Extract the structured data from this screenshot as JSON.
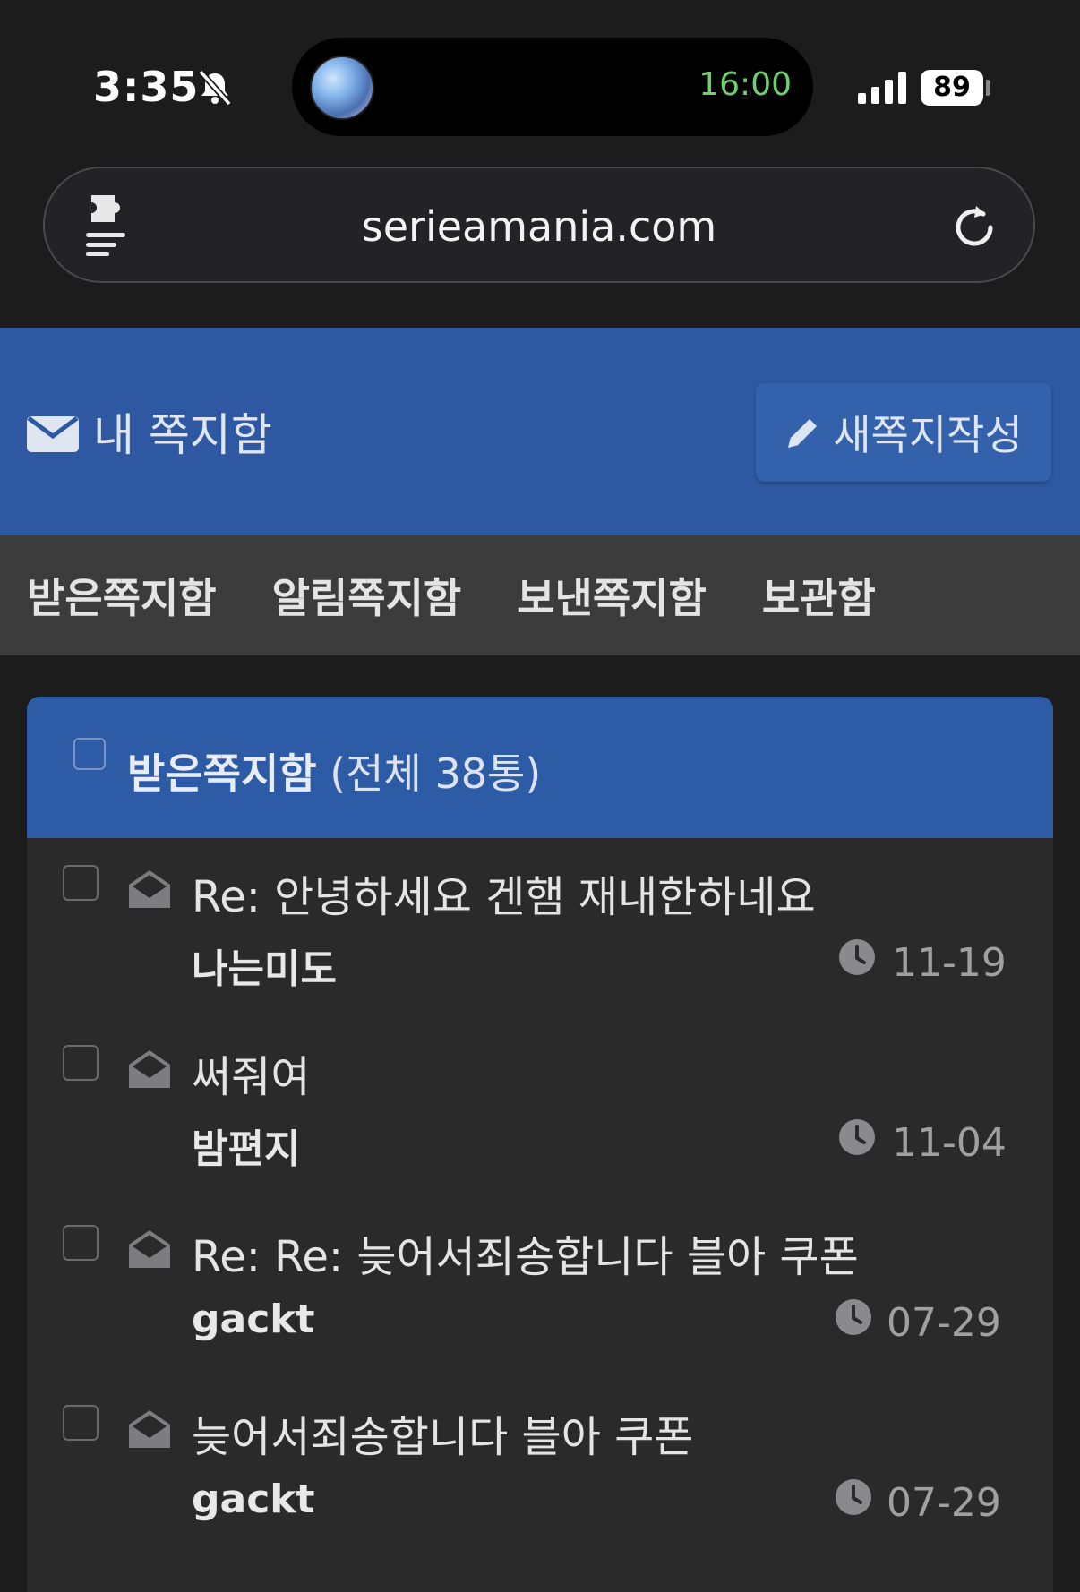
{
  "status_bar": {
    "time": "3:35",
    "live_activity_timer": "16:00",
    "battery": "89"
  },
  "browser": {
    "url": "serieamania.com"
  },
  "header": {
    "title": "내 쪽지함",
    "compose_label": "새쪽지작성"
  },
  "tabs": [
    {
      "label": "받은쪽지함"
    },
    {
      "label": "알림쪽지함"
    },
    {
      "label": "보낸쪽지함"
    },
    {
      "label": "보관함"
    }
  ],
  "inbox": {
    "title": "받은쪽지함",
    "count": "(전체 38통)",
    "messages": [
      {
        "subject": "Re: 안녕하세요 겐햄 재내한하네요",
        "sender": "나는미도",
        "date": "11-19"
      },
      {
        "subject": "써줘여",
        "sender": "밤편지",
        "date": "11-04"
      },
      {
        "subject": "Re: Re: 늦어서죄송합니다 블아 쿠폰",
        "sender": "gackt",
        "date": "07-29"
      },
      {
        "subject": "늦어서죄송합니다 블아 쿠폰",
        "sender": "gackt",
        "date": "07-29"
      }
    ]
  },
  "colors": {
    "header_blue": "#2e59a2",
    "tab_bar": "#3c3c3c",
    "card_bg": "#2a2a2b",
    "timer_green": "#6fd06f"
  },
  "icons": [
    "bell-muted-icon",
    "extension-icon",
    "reload-icon",
    "mail-icon",
    "pencil-icon",
    "envelope-open-icon",
    "clock-icon"
  ]
}
